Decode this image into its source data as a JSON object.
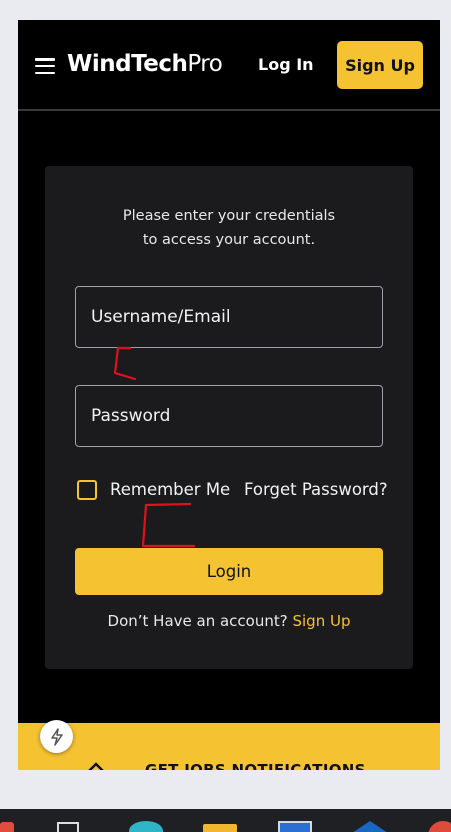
{
  "header": {
    "brand_bold": "WindTech",
    "brand_light": "Pro",
    "login_label": "Log In",
    "signup_label": "Sign Up"
  },
  "card": {
    "intro_line1": "Please enter your credentials",
    "intro_line2": "to access your account.",
    "username_placeholder": "Username/Email",
    "password_placeholder": "Password",
    "remember_label": "Remember Me",
    "forgot_label": "Forget Password?",
    "login_button": "Login",
    "signup_prompt": "Don’t Have an account?",
    "signup_link": "Sign Up"
  },
  "footer": {
    "banner_text": "GET JOBS NOTIFICATIONS"
  },
  "icons": {
    "menu": "hamburger-icon",
    "flash": "lightning-icon",
    "checkbox": "checkbox-unchecked-icon"
  },
  "colors": {
    "accent": "#f5c232",
    "background": "#000000",
    "card": "#1b1b1d",
    "annotation": "#e0101e"
  }
}
